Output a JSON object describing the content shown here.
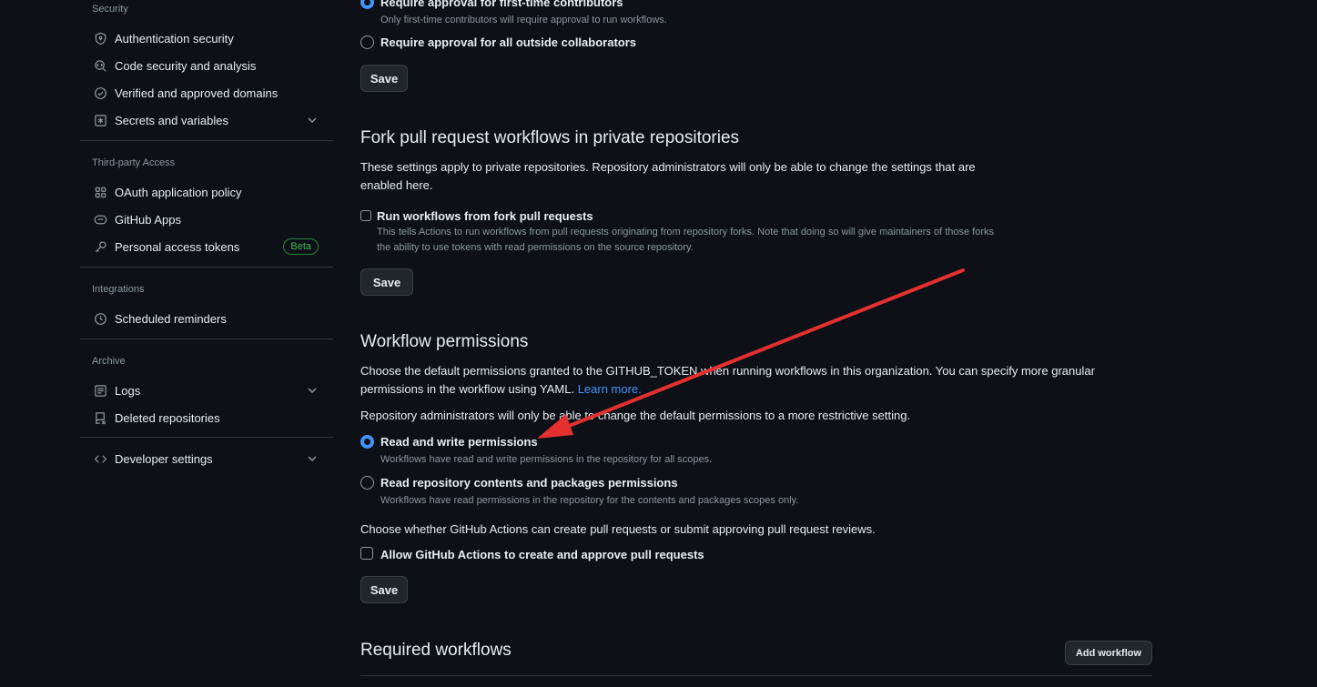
{
  "sidebar": {
    "security_title": "Security",
    "security_items": [
      {
        "label": "Authentication security",
        "icon": "shield-lock-icon"
      },
      {
        "label": "Code security and analysis",
        "icon": "codescan-icon"
      },
      {
        "label": "Verified and approved domains",
        "icon": "verified-icon"
      },
      {
        "label": "Secrets and variables",
        "icon": "asterisk-icon"
      }
    ],
    "third_party_title": "Third-party Access",
    "third_party_items": [
      {
        "label": "OAuth application policy",
        "icon": "apps-icon"
      },
      {
        "label": "GitHub Apps",
        "icon": "hubot-icon"
      },
      {
        "label": "Personal access tokens",
        "icon": "key-icon",
        "badge": "Beta"
      }
    ],
    "integrations_title": "Integrations",
    "integrations_items": [
      {
        "label": "Scheduled reminders",
        "icon": "clock-icon"
      }
    ],
    "archive_title": "Archive",
    "archive_items": [
      {
        "label": "Logs",
        "icon": "log-icon"
      },
      {
        "label": "Deleted repositories",
        "icon": "repo-deleted-icon"
      }
    ],
    "developer_settings": "Developer settings"
  },
  "main": {
    "approval": {
      "first_time_label": "Require approval for first-time contributors",
      "first_time_desc": "Only first-time contributors will require approval to run workflows.",
      "outside_label": "Require approval for all outside collaborators",
      "save": "Save"
    },
    "fork": {
      "title": "Fork pull request workflows in private repositories",
      "desc_line1": "These settings apply to private repositories. Repository administrators will only be able to change the settings that are",
      "desc_line2": "enabled here.",
      "run_label": "Run workflows from fork pull requests",
      "run_desc_line1": "This tells Actions to run workflows from pull requests originating from repository forks. Note that doing so will give maintainers of those forks",
      "run_desc_line2": "the ability to use tokens with read permissions on the source repository.",
      "save": "Save"
    },
    "workflow_permissions": {
      "title": "Workflow permissions",
      "desc_line1": "Choose the default permissions granted to the GITHUB_TOKEN when running workflows in this organization. You can specify more granular",
      "desc_line2": "permissions in the workflow using YAML.",
      "learn_more": "Learn more.",
      "admin_note": "Repository administrators will only be able to change the default permissions to a more restrictive setting.",
      "rw_label": "Read and write permissions",
      "rw_desc": "Workflows have read and write permissions in the repository for all scopes.",
      "read_label": "Read repository contents and packages permissions",
      "read_desc": "Workflows have read permissions in the repository for the contents and packages scopes only.",
      "pr_note": "Choose whether GitHub Actions can create pull requests or submit approving pull request reviews.",
      "allow_label": "Allow GitHub Actions to create and approve pull requests",
      "save": "Save"
    },
    "required_workflows": {
      "title": "Required workflows",
      "add_button": "Add workflow"
    }
  },
  "annotation_color": "#e5302f"
}
